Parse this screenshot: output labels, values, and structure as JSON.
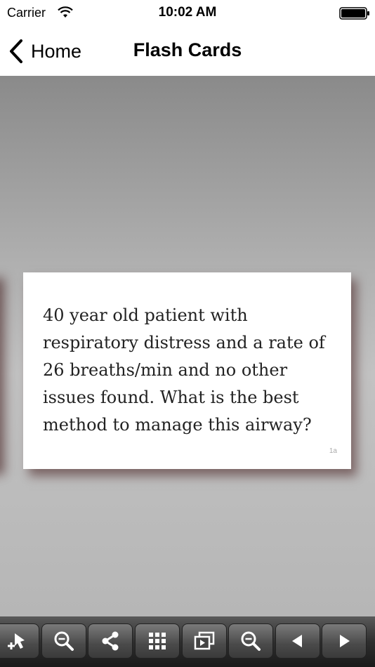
{
  "status_bar": {
    "carrier": "Carrier",
    "time": "10:02 AM"
  },
  "nav": {
    "back_label": "Home",
    "title": "Flash Cards"
  },
  "card": {
    "text": "40 year old patient with respiratory distress and a rate of 26 breaths/min and no other issues found. What is the best method to manage this airway?",
    "id": "1a"
  },
  "toolbar": {
    "buttons": [
      "add-bookmark-icon",
      "zoom-in-icon",
      "share-icon",
      "grid-icon",
      "slideshow-icon",
      "zoom-out-icon",
      "previous-icon",
      "next-icon"
    ]
  }
}
